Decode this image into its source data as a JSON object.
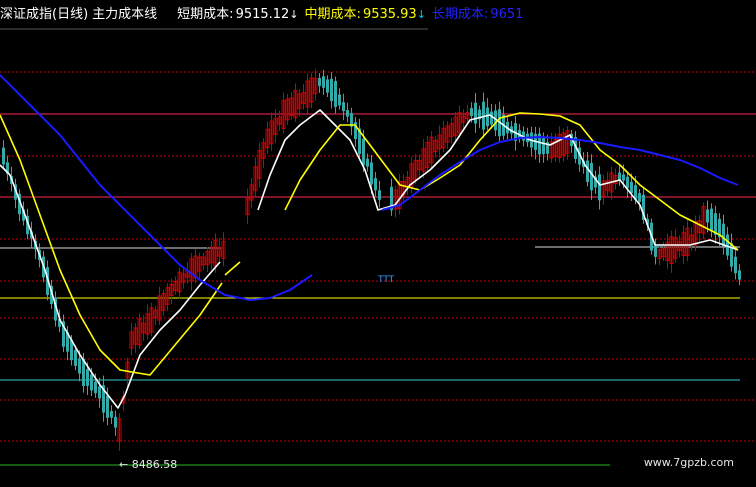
{
  "header": {
    "title": "深证成指(日线)",
    "subtitle": "主力成本线",
    "short_label": "短期成本:",
    "short_value": "9515.12",
    "mid_label": "中期成本:",
    "mid_value": "9535.93",
    "long_label": "长期成本:",
    "long_value": "9651",
    "arrow_down": "↓"
  },
  "min_label": "8486.58",
  "watermark": "www.7gpzb.com",
  "colors": {
    "background": "#000000",
    "up_candle": "#cc0000",
    "down_candle": "#33aaaa",
    "short_line": "#ffffff",
    "mid_line": "#ffff00",
    "long_line": "#1a1aff",
    "grid": "#cc0000"
  },
  "chart_data": {
    "type": "candlestick",
    "title": "深证成指(日线)",
    "ylim": [
      8420,
      10400
    ],
    "grid": "dashed horizontal",
    "series": [
      {
        "name": "短期成本",
        "last_value": 9515.12
      },
      {
        "name": "中期成本",
        "last_value": 9535.93
      },
      {
        "name": "长期成本",
        "last_value": 9651
      }
    ],
    "low_marker": 8486.58
  }
}
